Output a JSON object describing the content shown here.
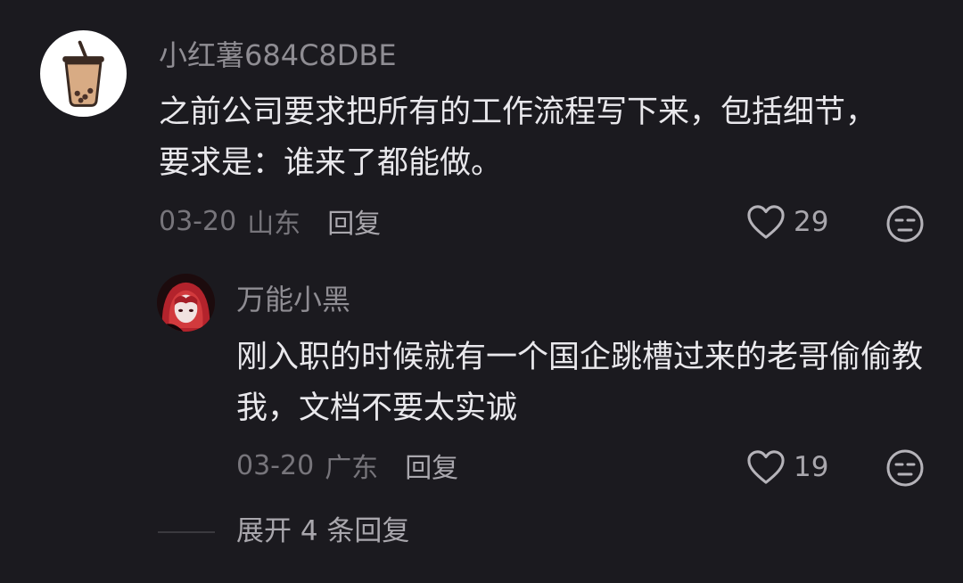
{
  "comment": {
    "username": "小红薯684C8DBE",
    "text": "之前公司要求把所有的工作流程写下来，包括细节，要求是：谁来了都能做。",
    "date": "03-20",
    "location": "山东",
    "reply_label": "回复",
    "likes": "29",
    "avatar_icon": "bubble-tea-icon",
    "reply": {
      "username": "万能小黑",
      "text": "刚入职的时候就有一个国企跳槽过来的老哥偷偷教我，文档不要太实诚",
      "date": "03-20",
      "location": "广东",
      "reply_label": "回复",
      "likes": "19",
      "avatar_icon": "anime-girl-avatar"
    }
  },
  "expand_replies": "展开 4 条回复",
  "colors": {
    "background": "#1b1a1f",
    "primary_text": "#e9e8ec",
    "secondary_text": "#8f8d93",
    "muted_text": "#77757b"
  }
}
